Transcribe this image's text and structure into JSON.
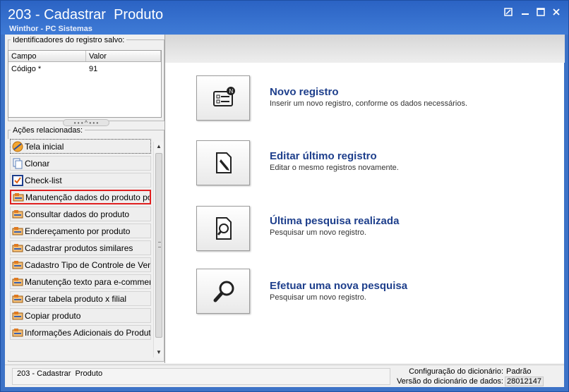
{
  "window": {
    "title": "203 - Cadastrar  Produto",
    "subtitle": "Winthor - PC Sistemas",
    "controls": [
      "restore-down",
      "minimize",
      "maximize",
      "close"
    ]
  },
  "identifiers": {
    "group_title": "Identificadores do registro salvo:",
    "columns": [
      "Campo",
      "Valor"
    ],
    "rows": [
      {
        "campo": "Código *",
        "valor": "91"
      }
    ]
  },
  "actions": {
    "group_title": "Ações relacionadas:",
    "items": [
      {
        "label": "Tela inicial",
        "icon": "home-icon"
      },
      {
        "label": "Clonar",
        "icon": "clone-icon"
      },
      {
        "label": "Check-list",
        "icon": "checklist-icon"
      },
      {
        "label": "Manutenção dados do produto por...",
        "icon": "form-icon"
      },
      {
        "label": "Consultar dados do produto",
        "icon": "form-icon"
      },
      {
        "label": "Endereçamento por produto",
        "icon": "form-icon"
      },
      {
        "label": "Cadastrar produtos similares",
        "icon": "form-icon"
      },
      {
        "label": "Cadastro Tipo de Controle de Ven...",
        "icon": "form-icon"
      },
      {
        "label": "Manutenção texto para e-commerce",
        "icon": "form-icon"
      },
      {
        "label": "Gerar tabela produto x filial",
        "icon": "form-icon"
      },
      {
        "label": "Copiar produto",
        "icon": "form-icon"
      },
      {
        "label": "Informações Adicionais do Produto",
        "icon": "form-icon"
      }
    ]
  },
  "cards": [
    {
      "title": "Novo registro",
      "description": "Inserir um novo registro, conforme os dados necessários.",
      "icon": "new-record-icon"
    },
    {
      "title": "Editar último registro",
      "description": "Editar o mesmo registros novamente.",
      "icon": "edit-record-icon"
    },
    {
      "title": "Última pesquisa realizada",
      "description": "Pesquisar um novo registro.",
      "icon": "last-search-icon"
    },
    {
      "title": "Efetuar uma nova pesquisa",
      "description": "Pesquisar um novo registro.",
      "icon": "new-search-icon"
    }
  ],
  "statusbar": {
    "left_text": "203 - Cadastrar  Produto",
    "config_label": "Configuração do dicionário:",
    "config_value": "Padrão",
    "version_label": "Versão do dicionário de dados:",
    "version_value": "28012147"
  },
  "colors": {
    "title_bar": "#3f7bd6",
    "card_title": "#1e3f8c",
    "highlight_border": "#e02020"
  }
}
